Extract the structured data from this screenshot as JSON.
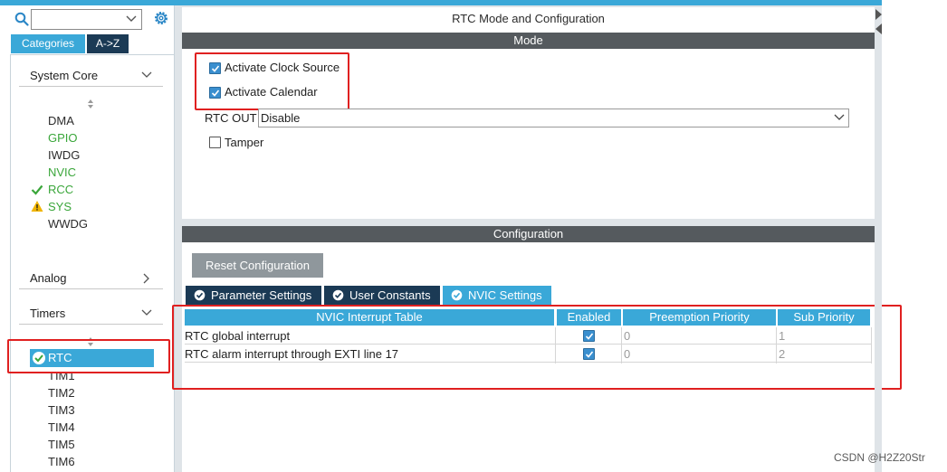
{
  "left_panel": {
    "search_value": "",
    "tabs": [
      "Categories",
      "A->Z"
    ],
    "groups": {
      "system_core": "System Core",
      "analog": "Analog",
      "timers": "Timers"
    },
    "system_core_items": [
      "DMA",
      "GPIO",
      "IWDG",
      "NVIC",
      "RCC",
      "SYS",
      "WWDG"
    ],
    "timers_items": [
      "RTC",
      "TIM1",
      "TIM2",
      "TIM3",
      "TIM4",
      "TIM5",
      "TIM6"
    ]
  },
  "main": {
    "title": "RTC Mode and Configuration",
    "mode_header": "Mode",
    "activate_clock_source": "Activate Clock Source",
    "activate_calendar": "Activate Calendar",
    "rtc_out_label": "RTC OUT",
    "rtc_out_value": "Disable",
    "tamper": "Tamper",
    "config_header": "Configuration",
    "reset_button": "Reset Configuration",
    "config_tabs": [
      "Parameter Settings",
      "User Constants",
      "NVIC Settings"
    ],
    "table": {
      "columns": [
        "NVIC Interrupt Table",
        "Enabled",
        "Preemption Priority",
        "Sub Priority"
      ],
      "rows": [
        {
          "name": "RTC global interrupt",
          "enabled": true,
          "preemption": "0",
          "sub": "1"
        },
        {
          "name": "RTC alarm interrupt through EXTI line 17",
          "enabled": true,
          "preemption": "0",
          "sub": "2"
        }
      ]
    }
  },
  "watermark": "CSDN @H2Z20Str",
  "colors": {
    "accent": "#3aa8d8",
    "dark_tab": "#1b3a55",
    "section_bar": "#555a5e",
    "highlight_border": "#e02020",
    "ok_green": "#3aa63a",
    "warn_yellow": "#f0b400"
  },
  "icons": [
    "search-icon",
    "gear-icon",
    "chevron-down-icon",
    "chevron-right-icon",
    "check-icon",
    "warning-icon",
    "check-circle-icon"
  ]
}
